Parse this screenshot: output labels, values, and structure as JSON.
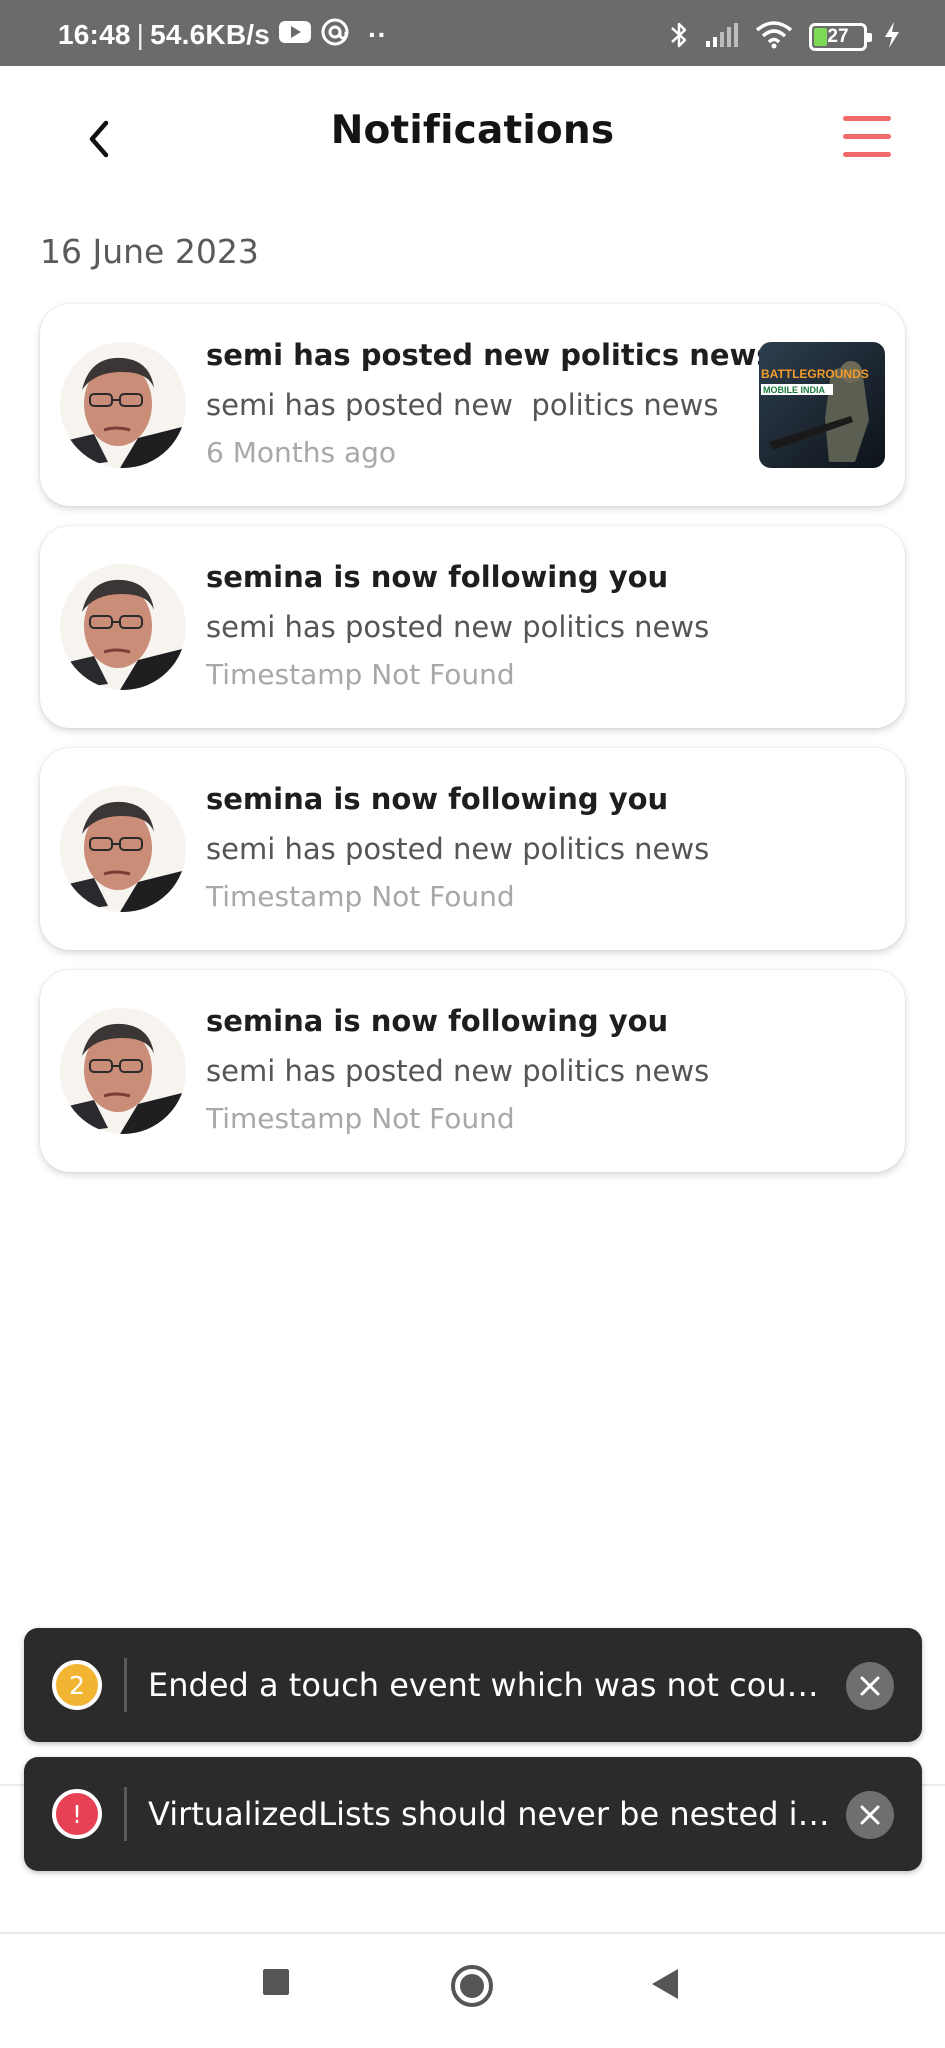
{
  "status_bar": {
    "time": "16:48",
    "speed": "54.6KB/s",
    "separator": "|",
    "more_dots": "··",
    "battery_level": 27,
    "battery_label": "27"
  },
  "header": {
    "title": "Notifications",
    "back_icon": "chevron-left-icon",
    "menu_icon": "hamburger-menu-icon",
    "accent_color": "#f06a6a"
  },
  "date_group": "16 June 2023",
  "notifications": [
    {
      "title": "semi has posted new politics news",
      "body": "semi has posted new  politics news",
      "time": "6 Months ago",
      "has_thumbnail": true,
      "thumbnail_text_1": "BATTLEGROUNDS",
      "thumbnail_text_2": "MOBILE INDIA"
    },
    {
      "title": "semina is now following you",
      "body": "semi has posted new politics news",
      "time": "Timestamp Not Found",
      "has_thumbnail": false
    },
    {
      "title": "semina is now following you",
      "body": "semi has posted new politics news",
      "time": "Timestamp Not Found",
      "has_thumbnail": false
    },
    {
      "title": "semina is now following you",
      "body": "semi has posted new politics news",
      "time": "Timestamp Not Found",
      "has_thumbnail": false
    }
  ],
  "toasts": [
    {
      "badge": "2",
      "badge_color": "#f2b533",
      "message": "Ended a touch event which was not counted in `trackedTouchCount`."
    },
    {
      "badge": "!",
      "badge_color": "#e64155",
      "message": "VirtualizedLists should never be nested inside plain ScrollViews"
    }
  ],
  "bottom_nav": {
    "items": [
      "home-icon",
      "search-icon",
      "bookmark-icon",
      "bell-icon"
    ],
    "active_color": "#f06a6a"
  },
  "system_nav": {
    "buttons": [
      "recents-square-icon",
      "home-circle-icon",
      "back-triangle-icon"
    ]
  }
}
